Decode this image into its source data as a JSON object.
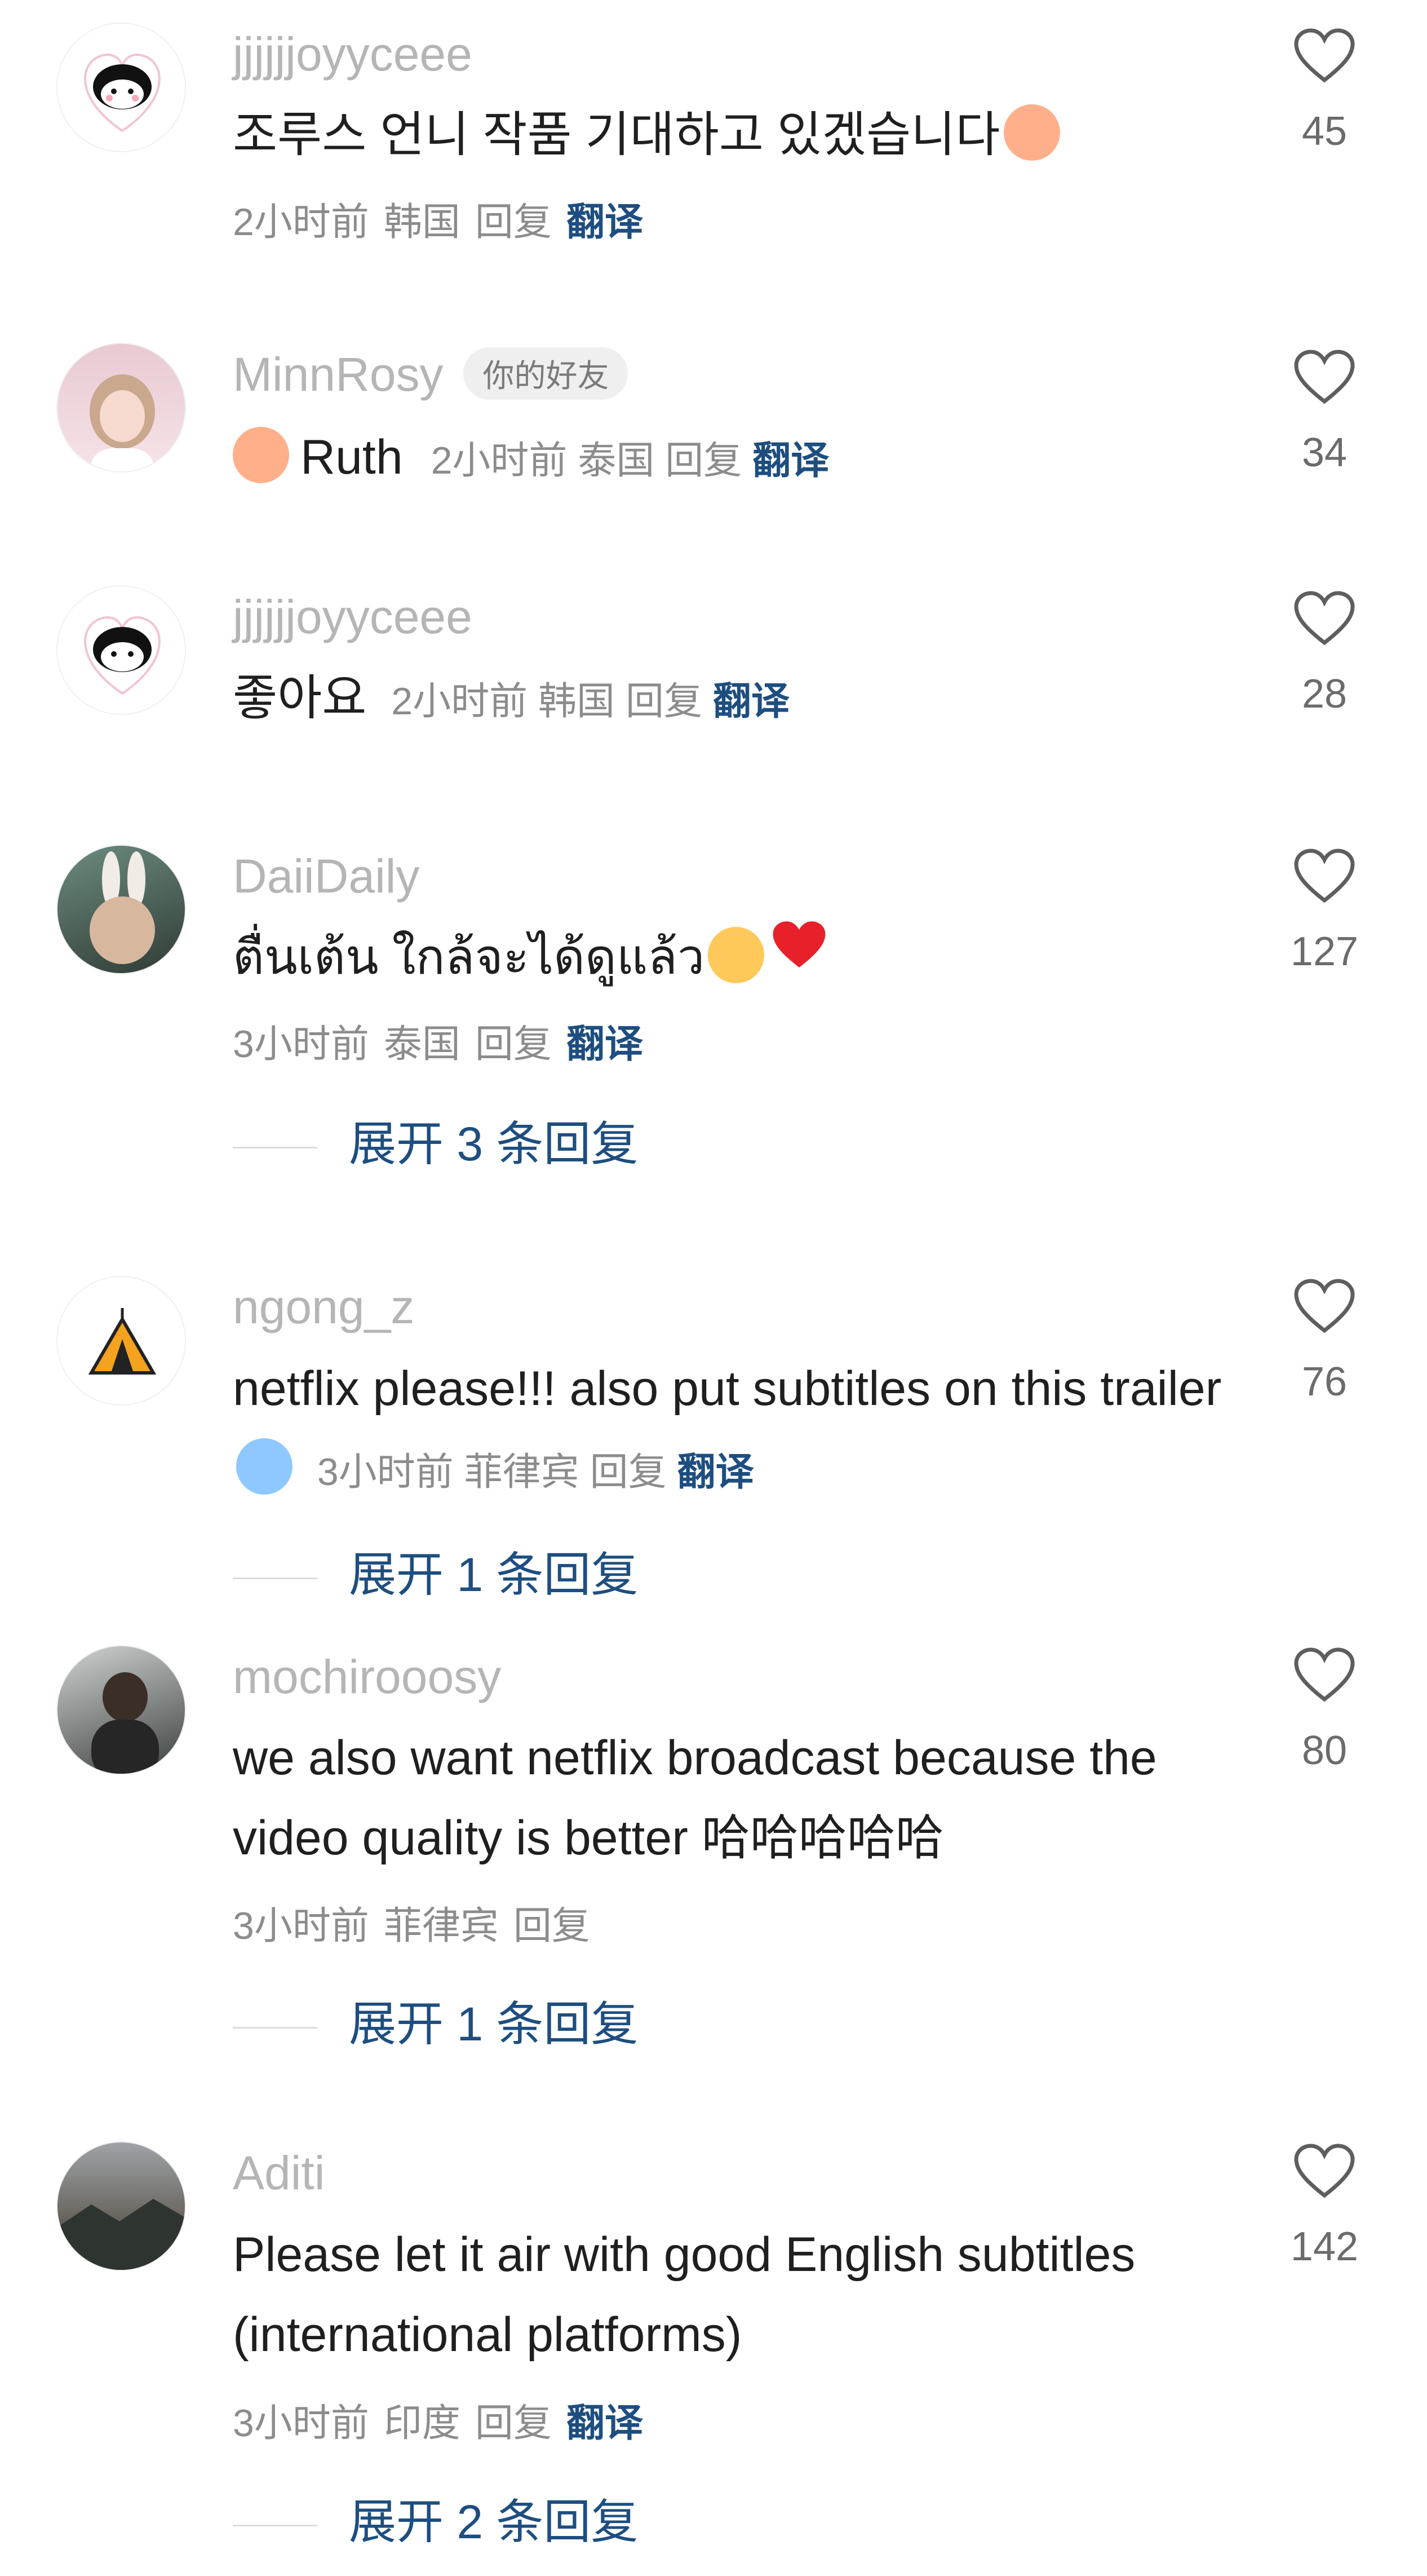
{
  "comments": [
    {
      "username": "jjjjjjoyyceee",
      "text": "조루스 언니 작품 기대하고 있겠습니다",
      "time": "2小时前",
      "region": "韩国",
      "reply": "回复",
      "translate": "翻译",
      "likes": "45",
      "avatar": "cat-sticker"
    },
    {
      "username": "MinnRosy",
      "badge": "你的好友",
      "text": "Ruth",
      "time": "2小时前",
      "region": "泰国",
      "reply": "回复",
      "translate": "翻译",
      "likes": "34",
      "avatar": "girl-photo"
    },
    {
      "username": "jjjjjjoyyceee",
      "text": "좋아요",
      "time": "2小时前",
      "region": "韩国",
      "reply": "回复",
      "translate": "翻译",
      "likes": "28",
      "avatar": "cat-sticker"
    },
    {
      "username": "DaiiDaily",
      "text": "ตื่นเต้น ใกล้จะได้ดูแล้ว",
      "time": "3小时前",
      "region": "泰国",
      "reply": "回复",
      "translate": "翻译",
      "likes": "127",
      "expand": "展开 3 条回复",
      "avatar": "bunny-photo"
    },
    {
      "username": "ngong_z",
      "text": "netflix please!!! also put subtitles on this trailer",
      "time": "3小时前",
      "region": "菲律宾",
      "reply": "回复",
      "translate": "翻译",
      "likes": "76",
      "expand": "展开 1 条回复",
      "avatar": "tent-icon"
    },
    {
      "username": "mochirooosy",
      "text": "we also want netflix broadcast because the video quality is better 哈哈哈哈哈",
      "time": "3小时前",
      "region": "菲律宾",
      "reply": "回复",
      "likes": "80",
      "expand": "展开 1 条回复",
      "avatar": "person-photo"
    },
    {
      "username": "Aditi",
      "text": "Please let it air with good English subtitles (international platforms)",
      "time": "3小时前",
      "region": "印度",
      "reply": "回复",
      "translate": "翻译",
      "likes": "142",
      "expand": "展开 2 条回复",
      "avatar": "landscape-photo"
    }
  ],
  "colors": {
    "username": "#b5b5b5",
    "text": "#1f1f1f",
    "meta": "#8c8c8c",
    "link": "#1e4e80"
  }
}
